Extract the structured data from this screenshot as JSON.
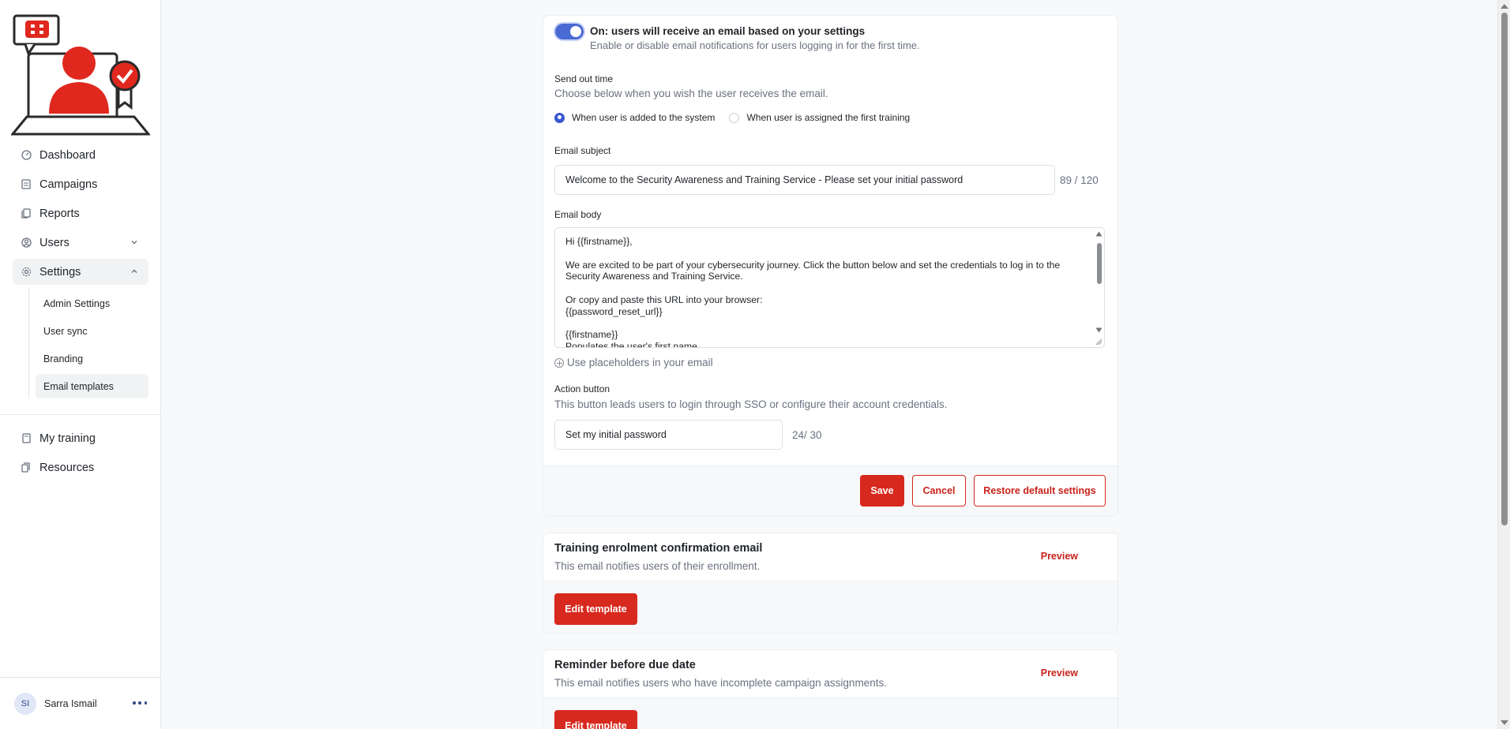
{
  "sidebar": {
    "logo_icon": "security-awareness-logo",
    "nav": [
      {
        "label": "Dashboard",
        "icon": "dashboard-icon"
      },
      {
        "label": "Campaigns",
        "icon": "campaigns-icon"
      },
      {
        "label": "Reports",
        "icon": "reports-icon"
      },
      {
        "label": "Users",
        "icon": "users-icon"
      },
      {
        "label": "Settings",
        "icon": "settings-icon"
      }
    ],
    "settings_sub": [
      "Admin Settings",
      "User sync",
      "Branding",
      "Email templates"
    ],
    "nav2": [
      {
        "label": "My training",
        "icon": "training-icon"
      },
      {
        "label": "Resources",
        "icon": "resources-icon"
      }
    ],
    "user": {
      "initials": "SI",
      "name": "Sarra Ismail"
    }
  },
  "main": {
    "toggle": {
      "state": "on",
      "title": "On: users will receive an email based on your settings",
      "description": "Enable or disable email notifications for users logging in for the first time."
    },
    "send_out": {
      "label": "Send out time",
      "hint": "Choose below when you wish the user receives the email.",
      "options": [
        "When user is added to the system",
        "When user is assigned the first training"
      ],
      "selected": "When user is added to the system"
    },
    "subject": {
      "label": "Email subject",
      "value": "Welcome to the Security Awareness and Training Service - Please set your initial password",
      "counter": "89 / 120"
    },
    "body": {
      "label": "Email body",
      "text": "Hi {{firstname}},\n\nWe are excited to be part of your cybersecurity journey. Click the button below and set the credentials to log in to the Security Awareness and Training Service.\n\nOr copy and paste this URL into your browser:\n{{password_reset_url}}\n\n{{firstname}}\nPopulates the user's first name."
    },
    "placeholders_link": "Use placeholders in your email",
    "action_button": {
      "label": "Action button",
      "hint": "This button leads users to login through SSO or configure their account credentials.",
      "value": "Set my initial password",
      "counter": "24/ 30"
    },
    "buttons": {
      "save": "Save",
      "cancel": "Cancel",
      "restore": "Restore default settings"
    }
  },
  "templates": [
    {
      "title": "Training enrolment confirmation email",
      "description": "This email notifies users of their enrollment.",
      "preview": "Preview",
      "edit": "Edit template"
    },
    {
      "title": "Reminder before due date",
      "description": "This email notifies users who have incomplete campaign assignments.",
      "preview": "Preview",
      "edit": "Edit template"
    }
  ],
  "colors": {
    "brand_red": "#d8291e",
    "toggle_blue": "#4a6bd3",
    "radio_blue": "#3858d0"
  }
}
